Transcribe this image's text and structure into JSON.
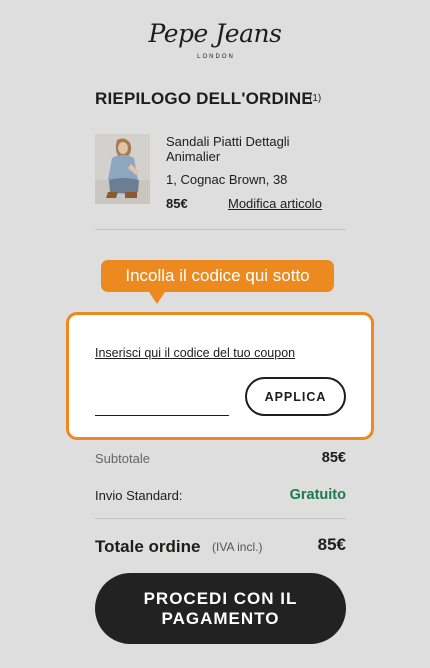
{
  "brand": {
    "name": "Pepe Jeans",
    "subtitle": "LONDON"
  },
  "summary": {
    "title": "RIEPILOGO DELL'ORDINE",
    "count": "(1)"
  },
  "product": {
    "name": "Sandali Piatti Dettagli Animalier",
    "variant": "1, Cognac Brown, 38",
    "price": "85€",
    "modify_label": "Modifica articolo"
  },
  "callout": {
    "text": "Incolla il codice qui sotto",
    "color": "#ec8a20"
  },
  "coupon": {
    "label": "Inserisci qui il codice del tuo coupon",
    "value": "",
    "apply_label": "APPLICA"
  },
  "totals": {
    "subtotal_label": "Subtotale",
    "subtotal_value": "85€",
    "shipping_label": "Invio Standard:",
    "shipping_value": "Gratuito",
    "total_label": "Totale ordine",
    "total_note": "(IVA incl.)",
    "total_value": "85€"
  },
  "checkout": {
    "label": "PROCEDI CON IL PAGAMENTO"
  },
  "colors": {
    "accent": "#ec8a20",
    "free_shipping": "#1a7a52",
    "button_dark": "#222222"
  }
}
